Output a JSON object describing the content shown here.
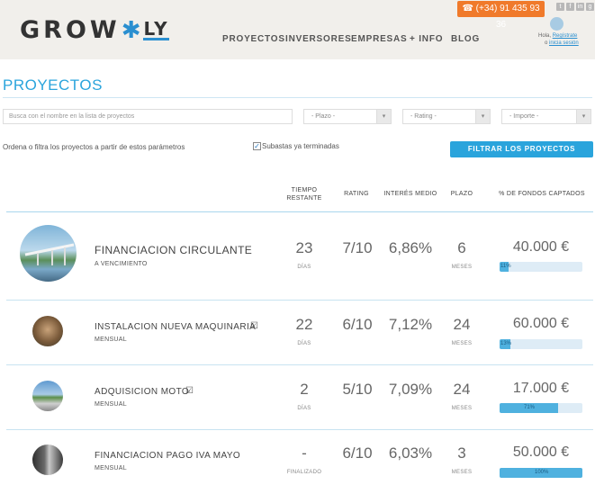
{
  "header": {
    "logo_left": "GROW",
    "logo_mark": "✱",
    "logo_right": "LY",
    "phone": "(+34) 91 435 93 36",
    "nav": [
      "PROYECTOS",
      "INVERSORES",
      "EMPRESAS",
      "+ INFO",
      "BLOG"
    ],
    "user": {
      "greeting": "Hola,",
      "register": "Regístrate",
      "or": "o",
      "login": "inicia sesión"
    },
    "social_icons": [
      "twitter-icon",
      "facebook-icon",
      "linkedin-icon",
      "googleplus-icon"
    ]
  },
  "page": {
    "title": "PROYECTOS",
    "search_placeholder": "Busca con el nombre en la lista de proyectos",
    "selects": [
      "- Plazo -",
      "- Rating -",
      "- Importe -"
    ],
    "help_text": "Ordena o filtra los proyectos a partir de estos parámetros",
    "checkbox_label": "Subastas ya terminadas",
    "filter_button": "FILTRAR LOS PROYECTOS"
  },
  "table": {
    "columns": {
      "tiempo_1": "TIEMPO",
      "tiempo_2": "RESTANTE",
      "rating": "RATING",
      "interes": "INTERÉS MEDIO",
      "plazo": "PLAZO",
      "fondos": "% DE FONDOS CAPTADOS"
    },
    "rows": [
      {
        "name": "FINANCIACION CIRCULANTE",
        "type": "A VENCIMIENTO",
        "time": "23",
        "time_unit": "DÍAS",
        "rating": "7/10",
        "interest": "6,86%",
        "term": "6",
        "term_unit": "MESES",
        "amount": "40.000 €",
        "progress": 0.11,
        "progress_label": "11%"
      },
      {
        "name": "INSTALACION NUEVA MAQUINARIA",
        "type": "MENSUAL",
        "time": "22",
        "time_unit": "DÍAS",
        "rating": "6/10",
        "interest": "7,12%",
        "term": "24",
        "term_unit": "MESES",
        "amount": "60.000 €",
        "progress": 0.13,
        "progress_label": "13%"
      },
      {
        "name": "ADQUISICION MOTO",
        "type": "MENSUAL",
        "time": "2",
        "time_unit": "DÍAS",
        "rating": "5/10",
        "interest": "7,09%",
        "term": "24",
        "term_unit": "MESES",
        "amount": "17.000 €",
        "progress": 0.71,
        "progress_label": "71%"
      },
      {
        "name": "FINANCIACION PAGO IVA MAYO",
        "type": "MENSUAL",
        "time": "-",
        "time_unit": "FINALIZADO",
        "rating": "6/10",
        "interest": "6,03%",
        "term": "3",
        "term_unit": "MESES",
        "amount": "50.000 €",
        "progress": 1.0,
        "progress_label": "100%"
      }
    ]
  },
  "colors": {
    "accent": "#2aa4dc",
    "phone_bg": "#f07a2b",
    "header_bg": "#f1efeb",
    "bar_fill": "#4fb1df"
  }
}
